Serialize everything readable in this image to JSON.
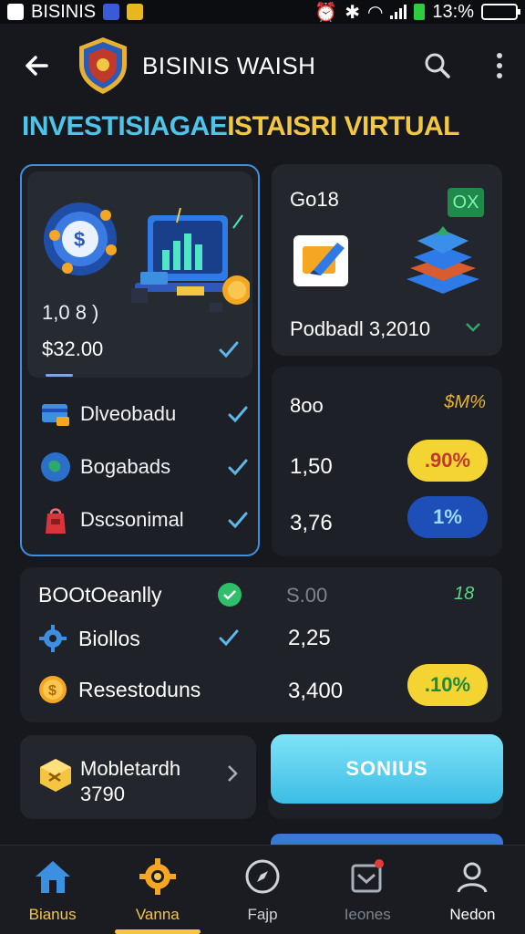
{
  "status_bar": {
    "carrier": "BISINIS",
    "time": "13:%",
    "icons": [
      "alarm-icon",
      "bluetooth-icon",
      "wifi-icon",
      "signal-icon",
      "battery-icon"
    ]
  },
  "header": {
    "title": "BISINIS WAISH",
    "logo": "shield-logo"
  },
  "heading": {
    "part1": "INVESTISIAGAE",
    "part2": "ISTAISRI VIRTUAL"
  },
  "card_main": {
    "value1": "1,0 8 )",
    "value2": "$32.00",
    "items": [
      {
        "label": "Dlveobadu",
        "icon": "card-icon"
      },
      {
        "label": "Bogabads",
        "icon": "globe-icon"
      },
      {
        "label": "Dscsonimal",
        "icon": "bag-icon"
      }
    ]
  },
  "card_top_right": {
    "label": "Go18",
    "badge": "OX",
    "footer": "Podbadl 3,2010"
  },
  "card_mid_right": {
    "title": "8oo",
    "tag": "$M%",
    "rows": [
      {
        "value": "1,50",
        "pill": ".90%"
      },
      {
        "value": "3,76",
        "pill": "1%"
      }
    ]
  },
  "card_wide": {
    "row1": {
      "label": "BOOtOeanlly",
      "amount": "S.00",
      "delta": "18"
    },
    "row2": {
      "label": "Biollos",
      "amount": "2,25"
    },
    "row3": {
      "label": "Resestoduns",
      "amount": "3,400",
      "pill": ".10%"
    }
  },
  "card_bottom_left": {
    "line1": "Mobletardh",
    "line2": "3790"
  },
  "cta": {
    "label": "SONIUS"
  },
  "nav": [
    {
      "label": "Bianus",
      "icon": "home-icon"
    },
    {
      "label": "Vanna",
      "icon": "gear-icon"
    },
    {
      "label": "Fajp",
      "icon": "compass-icon"
    },
    {
      "label": "Ieones",
      "icon": "inbox-icon"
    },
    {
      "label": "Nedon",
      "icon": "user-icon"
    }
  ],
  "colors": {
    "accent_blue": "#3d8fe0",
    "accent_yellow": "#f5c542",
    "cta": "#3cbde6",
    "background": "#16181d"
  }
}
